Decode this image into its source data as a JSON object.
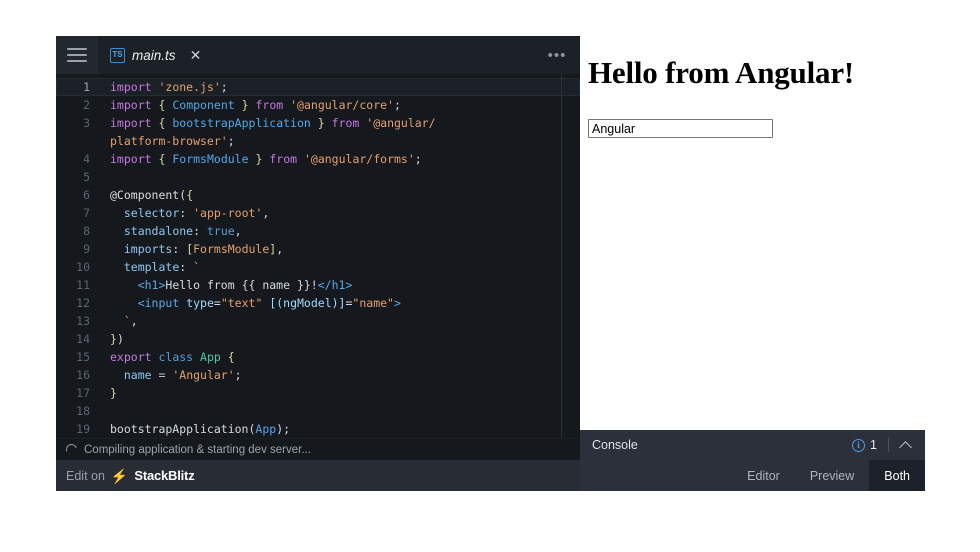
{
  "editor": {
    "menu_icon": "hamburger-icon",
    "tab": {
      "filetype_label": "TS",
      "filename": "main.ts",
      "close_label": "✕"
    },
    "more_label": "•••",
    "status_text": "Compiling application & starting dev server...",
    "code_lines": [
      {
        "n": "1",
        "tokens": [
          {
            "t": "import",
            "c": "k"
          },
          {
            "t": " ",
            "c": "cn"
          },
          {
            "t": "'zone.js'",
            "c": "s"
          },
          {
            "t": ";",
            "c": "cn"
          }
        ]
      },
      {
        "n": "2",
        "tokens": [
          {
            "t": "import",
            "c": "k"
          },
          {
            "t": " ",
            "c": "cn"
          },
          {
            "t": "{",
            "c": "br"
          },
          {
            "t": " ",
            "c": "cn"
          },
          {
            "t": "Component",
            "c": "id"
          },
          {
            "t": " ",
            "c": "cn"
          },
          {
            "t": "}",
            "c": "br"
          },
          {
            "t": " ",
            "c": "cn"
          },
          {
            "t": "from",
            "c": "k"
          },
          {
            "t": " ",
            "c": "cn"
          },
          {
            "t": "'@angular/core'",
            "c": "s"
          },
          {
            "t": ";",
            "c": "cn"
          }
        ]
      },
      {
        "n": "3",
        "tokens": [
          {
            "t": "import",
            "c": "k"
          },
          {
            "t": " ",
            "c": "cn"
          },
          {
            "t": "{",
            "c": "br"
          },
          {
            "t": " ",
            "c": "cn"
          },
          {
            "t": "bootstrapApplication",
            "c": "id"
          },
          {
            "t": " ",
            "c": "cn"
          },
          {
            "t": "}",
            "c": "br"
          },
          {
            "t": " ",
            "c": "cn"
          },
          {
            "t": "from",
            "c": "k"
          },
          {
            "t": " ",
            "c": "cn"
          },
          {
            "t": "'@angular/",
            "c": "s"
          }
        ]
      },
      {
        "n": "",
        "tokens": [
          {
            "t": "platform-browser'",
            "c": "s"
          },
          {
            "t": ";",
            "c": "cn"
          }
        ]
      },
      {
        "n": "4",
        "tokens": [
          {
            "t": "import",
            "c": "k"
          },
          {
            "t": " ",
            "c": "cn"
          },
          {
            "t": "{",
            "c": "br"
          },
          {
            "t": " ",
            "c": "cn"
          },
          {
            "t": "FormsModule",
            "c": "id"
          },
          {
            "t": " ",
            "c": "cn"
          },
          {
            "t": "}",
            "c": "br"
          },
          {
            "t": " ",
            "c": "cn"
          },
          {
            "t": "from",
            "c": "k"
          },
          {
            "t": " ",
            "c": "cn"
          },
          {
            "t": "'@angular/forms'",
            "c": "s"
          },
          {
            "t": ";",
            "c": "cn"
          }
        ]
      },
      {
        "n": "5",
        "tokens": []
      },
      {
        "n": "6",
        "tokens": [
          {
            "t": "@Component",
            "c": "dec"
          },
          {
            "t": "(",
            "c": "cn"
          },
          {
            "t": "{",
            "c": "br"
          }
        ]
      },
      {
        "n": "7",
        "tokens": [
          {
            "t": "  ",
            "c": "cn"
          },
          {
            "t": "selector",
            "c": "pn"
          },
          {
            "t": ": ",
            "c": "cn"
          },
          {
            "t": "'app-root'",
            "c": "s"
          },
          {
            "t": ",",
            "c": "cn"
          }
        ]
      },
      {
        "n": "8",
        "tokens": [
          {
            "t": "  ",
            "c": "cn"
          },
          {
            "t": "standalone",
            "c": "pn"
          },
          {
            "t": ": ",
            "c": "cn"
          },
          {
            "t": "true",
            "c": "kb"
          },
          {
            "t": ",",
            "c": "cn"
          }
        ]
      },
      {
        "n": "9",
        "tokens": [
          {
            "t": "  ",
            "c": "cn"
          },
          {
            "t": "imports",
            "c": "pn"
          },
          {
            "t": ": ",
            "c": "cn"
          },
          {
            "t": "[",
            "c": "br"
          },
          {
            "t": "FormsModule",
            "c": "s"
          },
          {
            "t": "]",
            "c": "br"
          },
          {
            "t": ",",
            "c": "cn"
          }
        ]
      },
      {
        "n": "10",
        "tokens": [
          {
            "t": "  ",
            "c": "cn"
          },
          {
            "t": "template",
            "c": "pn"
          },
          {
            "t": ": ",
            "c": "cn"
          },
          {
            "t": "`",
            "c": "s"
          }
        ]
      },
      {
        "n": "11",
        "tokens": [
          {
            "t": "    ",
            "c": "cn"
          },
          {
            "t": "<h1>",
            "c": "tg"
          },
          {
            "t": "Hello from {{ name }}!",
            "c": "cn"
          },
          {
            "t": "</h1>",
            "c": "tg"
          }
        ]
      },
      {
        "n": "12",
        "tokens": [
          {
            "t": "    ",
            "c": "cn"
          },
          {
            "t": "<input",
            "c": "tg"
          },
          {
            "t": " ",
            "c": "cn"
          },
          {
            "t": "type",
            "c": "at"
          },
          {
            "t": "=",
            "c": "cn"
          },
          {
            "t": "\"text\"",
            "c": "s"
          },
          {
            "t": " ",
            "c": "cn"
          },
          {
            "t": "[(ngModel)]",
            "c": "at"
          },
          {
            "t": "=",
            "c": "cn"
          },
          {
            "t": "\"name\"",
            "c": "s"
          },
          {
            "t": ">",
            "c": "tg"
          }
        ]
      },
      {
        "n": "13",
        "tokens": [
          {
            "t": "  `",
            "c": "s"
          },
          {
            "t": ",",
            "c": "cn"
          }
        ]
      },
      {
        "n": "14",
        "tokens": [
          {
            "t": "}",
            "c": "br"
          },
          {
            "t": ")",
            "c": "cn"
          }
        ]
      },
      {
        "n": "15",
        "tokens": [
          {
            "t": "export",
            "c": "k"
          },
          {
            "t": " ",
            "c": "cn"
          },
          {
            "t": "class",
            "c": "kb"
          },
          {
            "t": " ",
            "c": "cn"
          },
          {
            "t": "App",
            "c": "ty"
          },
          {
            "t": " ",
            "c": "cn"
          },
          {
            "t": "{",
            "c": "br"
          }
        ]
      },
      {
        "n": "16",
        "tokens": [
          {
            "t": "  ",
            "c": "cn"
          },
          {
            "t": "name",
            "c": "pn"
          },
          {
            "t": " = ",
            "c": "op"
          },
          {
            "t": "'Angular'",
            "c": "s"
          },
          {
            "t": ";",
            "c": "cn"
          }
        ]
      },
      {
        "n": "17",
        "tokens": [
          {
            "t": "}",
            "c": "br"
          }
        ]
      },
      {
        "n": "18",
        "tokens": []
      },
      {
        "n": "19",
        "tokens": [
          {
            "t": "bootstrapApplication",
            "c": "cn"
          },
          {
            "t": "(",
            "c": "cn"
          },
          {
            "t": "App",
            "c": "id"
          },
          {
            "t": ");",
            "c": "cn"
          }
        ]
      }
    ]
  },
  "preview": {
    "heading": "Hello from Angular!",
    "input_value": "Angular",
    "input_placeholder": ""
  },
  "console": {
    "title": "Console",
    "info_icon": "info-icon",
    "info_glyph": "i",
    "count": "1",
    "collapse_icon": "chevron-up-icon"
  },
  "footer": {
    "edit_on": "Edit on",
    "bolt_icon": "lightning-bolt-icon",
    "brand": "StackBlitz",
    "view_tabs": [
      {
        "label": "Editor",
        "active": false
      },
      {
        "label": "Preview",
        "active": false
      },
      {
        "label": "Both",
        "active": true
      }
    ]
  },
  "colors": {
    "editor_bg": "#15191e",
    "tabbar_bg": "#1c2128",
    "panel_bg": "#2b303a",
    "footer_left_bg": "#272c35",
    "accent_blue": "#3b8ef0",
    "info_blue": "#4a9eea",
    "string": "#e5a06c",
    "keyword": "#c678dd"
  }
}
